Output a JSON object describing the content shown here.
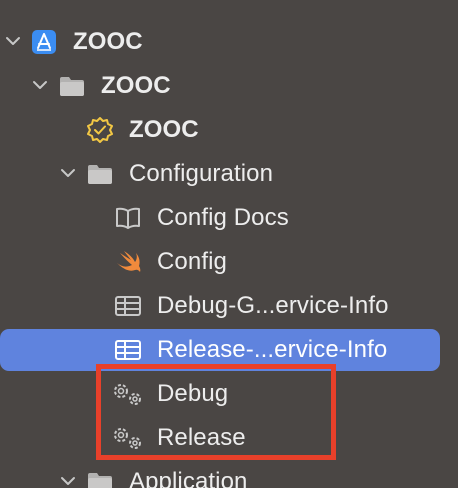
{
  "navigator": {
    "items": [
      {
        "label": "ZOOC",
        "icon": "project-icon",
        "expanded": true
      },
      {
        "label": "ZOOC",
        "icon": "folder-icon",
        "expanded": true
      },
      {
        "label": "ZOOC",
        "icon": "badge-icon"
      },
      {
        "label": "Configuration",
        "icon": "folder-icon",
        "expanded": true
      },
      {
        "label": "Config Docs",
        "icon": "book-icon"
      },
      {
        "label": "Config",
        "icon": "swift-icon"
      },
      {
        "label": "Debug-G...ervice-Info",
        "icon": "plist-icon"
      },
      {
        "label": "Release-...ervice-Info",
        "icon": "plist-icon",
        "selected": true
      },
      {
        "label": "Debug",
        "icon": "gears-icon"
      },
      {
        "label": "Release",
        "icon": "gears-icon"
      },
      {
        "label": "Application",
        "icon": "folder-icon",
        "expanded": true
      }
    ]
  },
  "colors": {
    "background": "#4a4644",
    "selection": "#5f83de",
    "highlight": "#e8402a",
    "text": "#ededed"
  }
}
